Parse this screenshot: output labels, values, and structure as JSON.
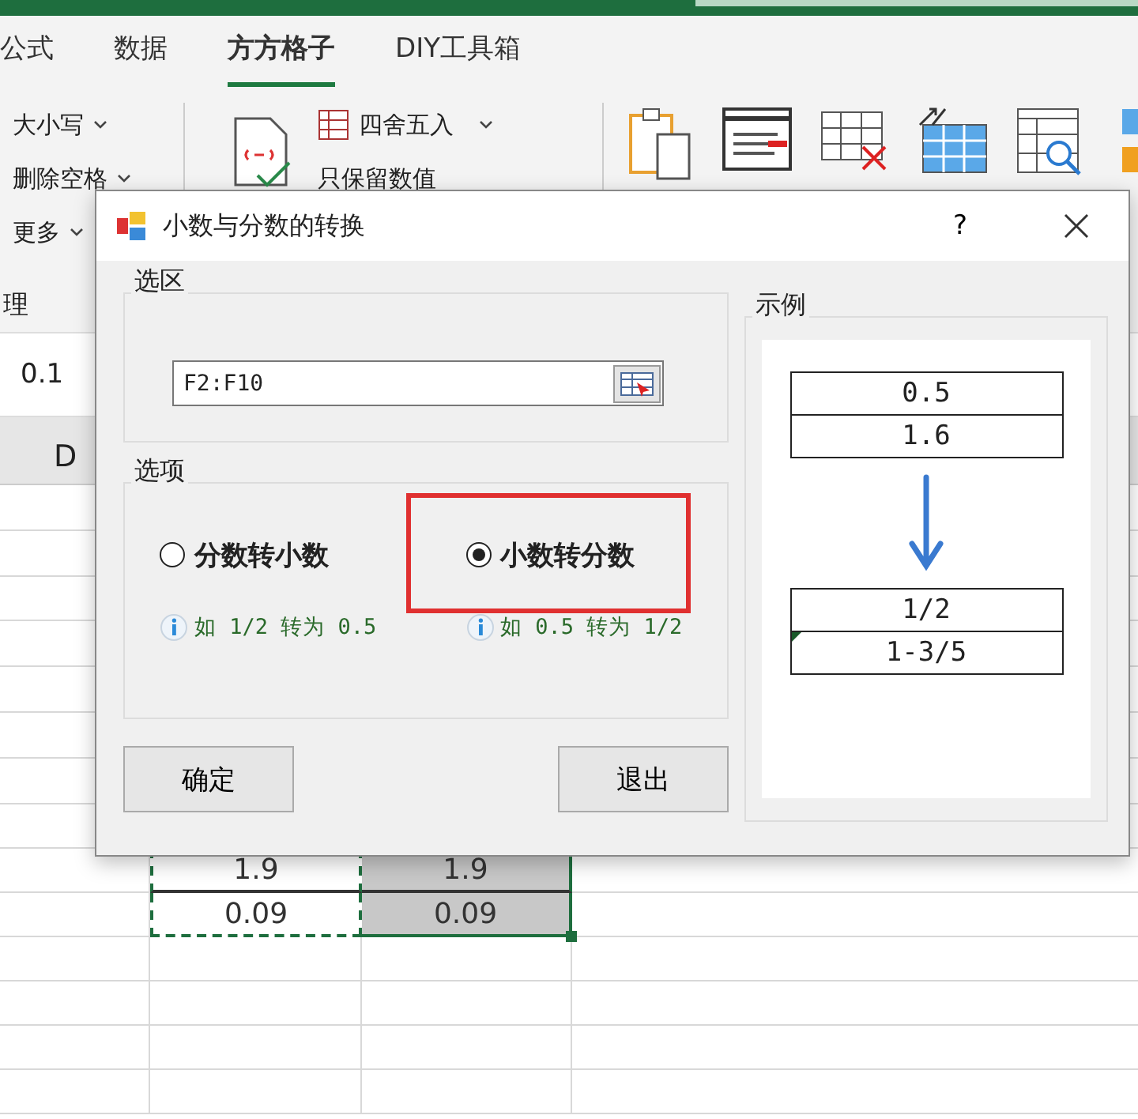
{
  "ribbon_tabs": [
    {
      "label": "公式",
      "selected": false
    },
    {
      "label": "数据",
      "selected": false
    },
    {
      "label": "方方格子",
      "selected": true
    },
    {
      "label": "DIY工具箱",
      "selected": false
    }
  ],
  "ribbon": {
    "text_items": [
      "大小写",
      "删除空格",
      "更多"
    ],
    "group_label": "理",
    "number_items": [
      "四舍五入",
      "只保留数值"
    ]
  },
  "formula_bar": {
    "value": "0.1"
  },
  "column_header": "D",
  "cells": [
    [
      "1.9",
      "1.9"
    ],
    [
      "0.09",
      "0.09"
    ]
  ],
  "dialog": {
    "title": "小数与分数的转换",
    "help": "?",
    "selection_group": {
      "label": "选区",
      "value": "F2:F10"
    },
    "options_group": {
      "label": "选项",
      "options": [
        {
          "label": "分数转小数",
          "hint": "如 1/2 转为 0.5",
          "selected": false
        },
        {
          "label": "小数转分数",
          "hint": "如 0.5 转为 1/2",
          "selected": true
        }
      ]
    },
    "buttons": [
      "确定",
      "退出"
    ],
    "example": {
      "label": "示例",
      "before": [
        "0.5",
        "1.6"
      ],
      "after": [
        "1/2",
        "1-3/5"
      ]
    }
  }
}
